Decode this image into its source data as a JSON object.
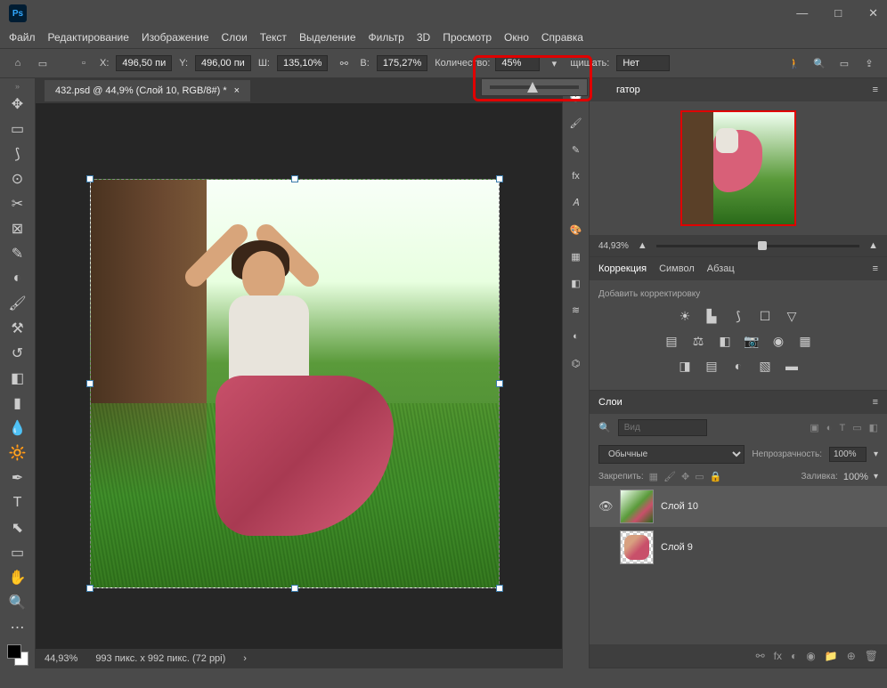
{
  "titlebar": {
    "logo": "Ps"
  },
  "menu": {
    "file": "Файл",
    "edit": "Редактирование",
    "image": "Изображение",
    "layer": "Слои",
    "type": "Текст",
    "select": "Выделение",
    "filter": "Фильтр",
    "td": "3D",
    "view": "Просмотр",
    "window": "Окно",
    "help": "Справка"
  },
  "options": {
    "x_label": "X:",
    "x_val": "496,50 пи",
    "y_label": "Y:",
    "y_val": "496,00 пи",
    "w_label": "Ш:",
    "w_val": "135,10%",
    "h_label": "В:",
    "h_val": "175,27%",
    "qty_label": "Количество:",
    "qty_val": "45%",
    "protect_label": "щищать:",
    "protect_val": "Нет"
  },
  "tabs": {
    "doc": "432.psd @ 44,9% (Слой 10, RGB/8#) *"
  },
  "nav": {
    "tab": "гатор",
    "zoom": "44,93%"
  },
  "adjust": {
    "tab1": "Коррекция",
    "tab2": "Символ",
    "tab3": "Абзац",
    "add": "Добавить корректировку"
  },
  "layers": {
    "tab": "Слои",
    "search_ph": "Вид",
    "blend": "Обычные",
    "opacity_lbl": "Непрозрачность:",
    "opacity_val": "100%",
    "lock_lbl": "Закрепить:",
    "fill_lbl": "Заливка:",
    "fill_val": "100%",
    "layer1": "Слой 10",
    "layer2": "Слой 9"
  },
  "status": {
    "zoom": "44,93%",
    "dims": "993 пикс. x 992 пикс. (72 ppi)"
  }
}
